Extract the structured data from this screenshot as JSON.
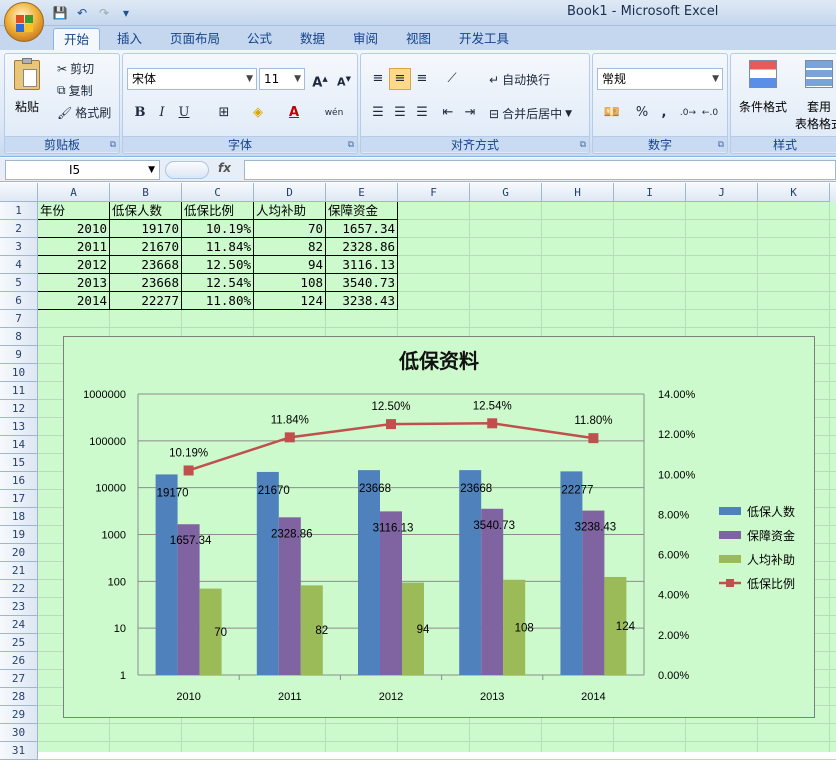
{
  "window": {
    "title": "Book1 - Microsoft Excel"
  },
  "quick_access": [
    "save-icon",
    "undo-icon",
    "redo-icon",
    "customize-icon"
  ],
  "tabs": [
    "开始",
    "插入",
    "页面布局",
    "公式",
    "数据",
    "审阅",
    "视图",
    "开发工具"
  ],
  "ribbon": {
    "clipboard": {
      "label": "剪贴板",
      "paste": "粘贴",
      "cut": "剪切",
      "copy": "复制",
      "format_painter": "格式刷"
    },
    "font": {
      "label": "字体",
      "font_name": "宋体",
      "font_size": "11",
      "bold": "B",
      "italic": "I",
      "underline": "U",
      "phonetic": "wén"
    },
    "alignment": {
      "label": "对齐方式",
      "wrap_text": "自动换行",
      "merge_center": "合并后居中"
    },
    "number": {
      "label": "数字",
      "format": "常规",
      "percent": "%",
      "comma": ","
    },
    "styles": {
      "label": "样式",
      "conditional": "条件格式",
      "table": "套用",
      "table2": "表格格式"
    }
  },
  "formula_bar": {
    "name_box": "I5",
    "fx": "fx",
    "value": ""
  },
  "columns": [
    "A",
    "B",
    "C",
    "D",
    "E",
    "F",
    "G",
    "H",
    "I",
    "J",
    "K"
  ],
  "rows": [
    "1",
    "2",
    "3",
    "4",
    "5",
    "6",
    "7",
    "8",
    "9",
    "10",
    "11",
    "12",
    "13",
    "14",
    "15",
    "16",
    "17",
    "18",
    "19",
    "20",
    "21",
    "22",
    "23",
    "24",
    "25",
    "26",
    "27",
    "28",
    "29",
    "30",
    "31"
  ],
  "sheet": {
    "headers": [
      "年份",
      "低保人数",
      "低保比例",
      "人均补助",
      "保障资金"
    ],
    "data": [
      [
        "2010",
        "19170",
        "10.19%",
        "70",
        "1657.34"
      ],
      [
        "2011",
        "21670",
        "11.84%",
        "82",
        "2328.86"
      ],
      [
        "2012",
        "23668",
        "12.50%",
        "94",
        "3116.13"
      ],
      [
        "2013",
        "23668",
        "12.54%",
        "108",
        "3540.73"
      ],
      [
        "2014",
        "22277",
        "11.80%",
        "124",
        "3238.43"
      ]
    ]
  },
  "chart_data": {
    "type": "bar",
    "title": "低保资料",
    "categories": [
      "2010",
      "2011",
      "2012",
      "2013",
      "2014"
    ],
    "series": [
      {
        "name": "低保人数",
        "type": "bar",
        "axis": "left-log",
        "color": "#4f81bd",
        "values": [
          19170,
          21670,
          23668,
          23668,
          22277
        ],
        "labels": [
          "19170",
          "21670",
          "23668",
          "23668",
          "22277"
        ]
      },
      {
        "name": "保障资金",
        "type": "bar",
        "axis": "left-log",
        "color": "#8064a2",
        "values": [
          1657.34,
          2328.86,
          3116.13,
          3540.73,
          3238.43
        ],
        "labels": [
          "1657.34",
          "2328.86",
          "3116.13",
          "3540.73",
          "3238.43"
        ]
      },
      {
        "name": "人均补助",
        "type": "bar",
        "axis": "left-log",
        "color": "#9bbb59",
        "values": [
          70,
          82,
          94,
          108,
          124
        ],
        "labels": [
          "70",
          "82",
          "94",
          "108",
          "124"
        ]
      },
      {
        "name": "低保比例",
        "type": "line",
        "axis": "right",
        "color": "#c0504d",
        "values": [
          10.19,
          11.84,
          12.5,
          12.54,
          11.8
        ],
        "labels": [
          "10.19%",
          "11.84%",
          "12.50%",
          "12.54%",
          "11.80%"
        ]
      }
    ],
    "y_left": {
      "scale": "log",
      "range": [
        1,
        1000000
      ],
      "ticks": [
        "1",
        "10",
        "100",
        "1000",
        "10000",
        "100000",
        "1000000"
      ]
    },
    "y_right": {
      "range": [
        0,
        14
      ],
      "ticks": [
        "0.00%",
        "2.00%",
        "4.00%",
        "6.00%",
        "8.00%",
        "10.00%",
        "12.00%",
        "14.00%"
      ]
    },
    "grid": true,
    "legend": "right"
  }
}
